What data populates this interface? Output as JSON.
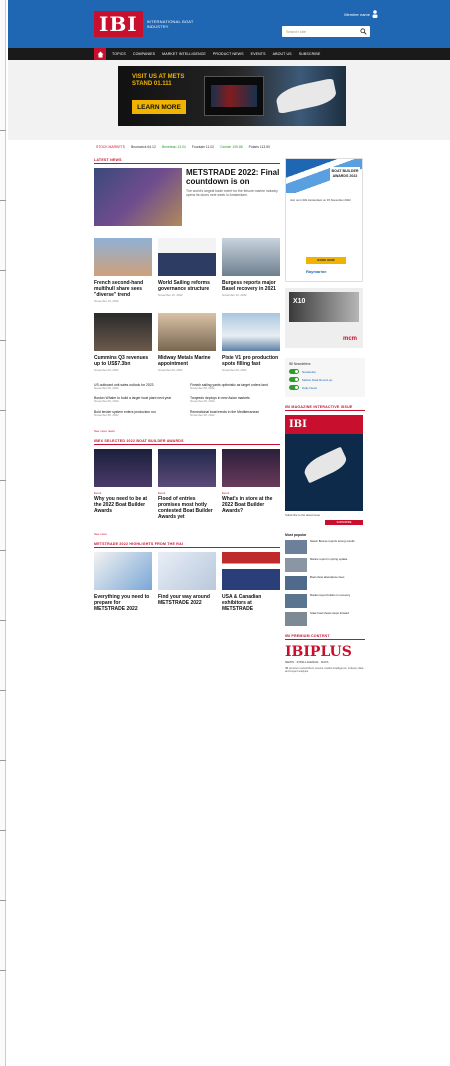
{
  "header": {
    "logo": "IBI",
    "logo_sub": "INTERNATIONAL BOAT INDUSTRY",
    "account": "Member name",
    "search_placeholder": "Search site"
  },
  "nav": {
    "items": [
      "TOPICS",
      "COMPANIES",
      "MARKET INTELLIGENCE",
      "PRODUCT NEWS",
      "EVENTS",
      "ABOUT US",
      "SUBSCRIBE"
    ]
  },
  "banner": {
    "line1": "VISIT US AT METS",
    "line2": "STAND 01.111",
    "cta": "LEARN MORE"
  },
  "ticker": [
    "STOCK MARKETS",
    "Brunswick 64.12",
    "Beneteau 13.04",
    "Fountain 11.02",
    "Garmin 105.88",
    "Polaris 113.50"
  ],
  "latest": {
    "heading": "LATEST NEWS",
    "feature_title": "METSTRADE 2022: Final countdown is on",
    "feature_text": "The world's largest trade event for the leisure marine industry opens its doors next week in Amsterdam.",
    "cards_row1": [
      {
        "title": "French second-hand multihull share sees \"diverse\" trend",
        "meta": "November 10, 2022"
      },
      {
        "title": "World Sailing reforms governance structure",
        "meta": "November 10, 2022"
      },
      {
        "title": "Burgess reports major Basel recovery in 2021",
        "meta": "November 10, 2022"
      }
    ],
    "cards_row2": [
      {
        "title": "Cummins Q3 revenues up to US$7.3bn",
        "meta": "November 09, 2022"
      },
      {
        "title": "Midway Metals Marine appointment",
        "meta": "November 09, 2022"
      },
      {
        "title": "Pixie V1 pro production spots filling fast",
        "meta": "November 09, 2022"
      }
    ],
    "list_left": [
      {
        "t": "US outboard unit sales outlook for 2023",
        "d": "November 09, 2022"
      },
      {
        "t": "Boston Whaler to build a larger boat plant next year",
        "d": "November 09, 2022"
      },
      {
        "t": "Bold tender system enters production run",
        "d": "November 08, 2022"
      }
    ],
    "list_right": [
      {
        "t": "Finnish sailing yards optimistic as target orders land",
        "d": "November 08, 2022"
      },
      {
        "t": "Torqeedo deploys in new Asian markets",
        "d": "November 08, 2022"
      },
      {
        "t": "Recreational boat trends in the Mediterranean",
        "d": "November 08, 2022"
      }
    ],
    "more": "See more news"
  },
  "awards": {
    "heading": "IBEX SELECTED 2022 BOAT BUILDER AWARDS",
    "cards": [
      {
        "cat": "Event",
        "title": "Why you need to be at the 2022 Boat Builder Awards"
      },
      {
        "cat": "Event",
        "title": "Flood of entries promises most hotly contested Boat Builder Awards yet"
      },
      {
        "cat": "Event",
        "title": "What's in store at the 2022 Boat Builder Awards?"
      }
    ],
    "more": "See more"
  },
  "mets": {
    "heading": "METSTRADE 2022 HIGHLIGHTS FROM THE RAI",
    "cards": [
      {
        "title": "Everything you need to prepare for METSTRADE 2022"
      },
      {
        "title": "Find your way around METSTRADE 2022"
      },
      {
        "title": "USA & Canadian exhibitors at METSTRADE"
      }
    ]
  },
  "sidebar": {
    "ad1_award": "BOAT BUILDER AWARDS 2022",
    "ad1_text": "Join us in RAI Amsterdam on 15 November 2022",
    "ad1_cta": "BOOK NOW",
    "ad1_sponsor": "Raymarine",
    "ad2_title": "X10",
    "ad2_brand": "mcm",
    "toggles_heading": "IBI Newsletters",
    "toggles": [
      "Newsletter",
      "Market Data Round-up",
      "Daily News"
    ],
    "mag_heading": "IBI MAGAZINE INTERACTIVE ISSUE",
    "mag_logo": "IBI",
    "mag_text": "Subscribe to the latest issue",
    "mag_sub": "SUBSCRIBE",
    "pop_heading": "Most popular",
    "pop": [
      "Nautic Bourse reports strong results",
      "Marine report in spring update",
      "Boat show attendance rises",
      "Market report builds on recovery",
      "Solar boat shows steps forward"
    ],
    "plus_heading": "IBI PREMIUM CONTENT",
    "plus_logo": "IBIPLUS",
    "plus_tag": "NEWS · INTELLIGENCE · DATA",
    "plus_text": "IBI premium subscribers receive market intelligence, industry data and expert analysis."
  }
}
